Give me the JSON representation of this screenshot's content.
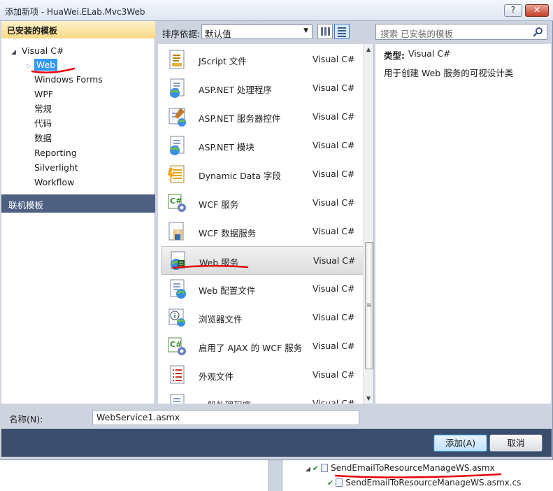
{
  "window": {
    "title": "添加新项 - HuaWei.ELab.Mvc3Web",
    "help_label": "?",
    "close_label": "✕"
  },
  "left_panel": {
    "installed_header": "已安装的模板",
    "root_item": "Visual C#",
    "selected_item": "Web",
    "items": [
      "Windows Forms",
      "WPF",
      "常规",
      "代码",
      "数据",
      "Reporting",
      "Silverlight",
      "Workflow"
    ],
    "online_header": "联机模板"
  },
  "toolbar": {
    "sort_label": "排序依据:",
    "sort_value": "默认值",
    "search_placeholder": "搜索 已安装的模板"
  },
  "templates": [
    {
      "name": "JScript 文件",
      "lang": "Visual C#",
      "icon": "jscript-file-icon"
    },
    {
      "name": "ASP.NET 处理程序",
      "lang": "Visual C#",
      "icon": "aspnet-handler-icon"
    },
    {
      "name": "ASP.NET 服务器控件",
      "lang": "Visual C#",
      "icon": "aspnet-server-control-icon"
    },
    {
      "name": "ASP.NET 模块",
      "lang": "Visual C#",
      "icon": "aspnet-module-icon"
    },
    {
      "name": "Dynamic Data 字段",
      "lang": "Visual C#",
      "icon": "dynamic-data-field-icon"
    },
    {
      "name": "WCF 服务",
      "lang": "Visual C#",
      "icon": "wcf-service-icon"
    },
    {
      "name": "WCF 数据服务",
      "lang": "Visual C#",
      "icon": "wcf-data-service-icon"
    },
    {
      "name": "Web 服务",
      "lang": "Visual C#",
      "icon": "web-service-icon",
      "selected": true
    },
    {
      "name": "Web 配置文件",
      "lang": "Visual C#",
      "icon": "web-config-icon"
    },
    {
      "name": "浏览器文件",
      "lang": "Visual C#",
      "icon": "browser-file-icon"
    },
    {
      "name": "启用了 AJAX 的 WCF 服务",
      "lang": "Visual C#",
      "icon": "ajax-wcf-service-icon"
    },
    {
      "name": "外观文件",
      "lang": "Visual C#",
      "icon": "skin-file-icon"
    },
    {
      "name": "一般处理程序",
      "lang": "Visual C#",
      "icon": "generic-handler-icon"
    }
  ],
  "description": {
    "type_label": "类型:",
    "type_value": "Visual C#",
    "text": "用于创建 Web 服务的可视设计类"
  },
  "name_field": {
    "label": "名称(N):",
    "value": "WebService1.asmx"
  },
  "buttons": {
    "add": "添加(A)",
    "cancel": "取消"
  },
  "solution_explorer": {
    "file1": "SendEmailToResourceManageWS.asmx",
    "file2": "SendEmailToResourceManageWS.asmx.cs"
  },
  "colors": {
    "installed_header": "#f9d984",
    "online_header": "#4d6082",
    "button_bar": "#3b4d6d",
    "selection": "#3399ff",
    "annotation": "#e8000b"
  }
}
